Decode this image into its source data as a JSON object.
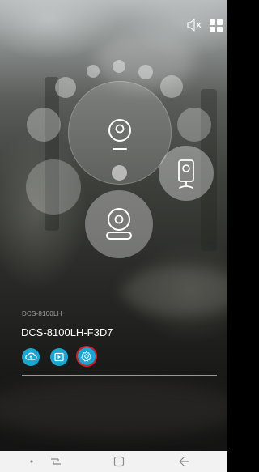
{
  "header": {
    "mute_icon": "speaker-muted-icon",
    "grid_icon": "grid-view-icon"
  },
  "device": {
    "model": "DCS-8100LH",
    "name": "DCS-8100LH-F3D7"
  },
  "actions": [
    {
      "name": "cloud-recording",
      "icon": "cloud-icon"
    },
    {
      "name": "local-playback",
      "icon": "playback-icon"
    },
    {
      "name": "settings",
      "icon": "gear-icon",
      "highlighted": true
    }
  ],
  "camera_icons": [
    "camera-pan-icon",
    "camera-dome-icon",
    "camera-mini-icon"
  ],
  "colors": {
    "accent": "#17a7d2",
    "highlight": "#e01b1b",
    "navbar": "#f2f2f2"
  },
  "navbar": {
    "icons": [
      "dot-icon",
      "recent-apps-icon",
      "home-icon",
      "back-icon"
    ]
  }
}
